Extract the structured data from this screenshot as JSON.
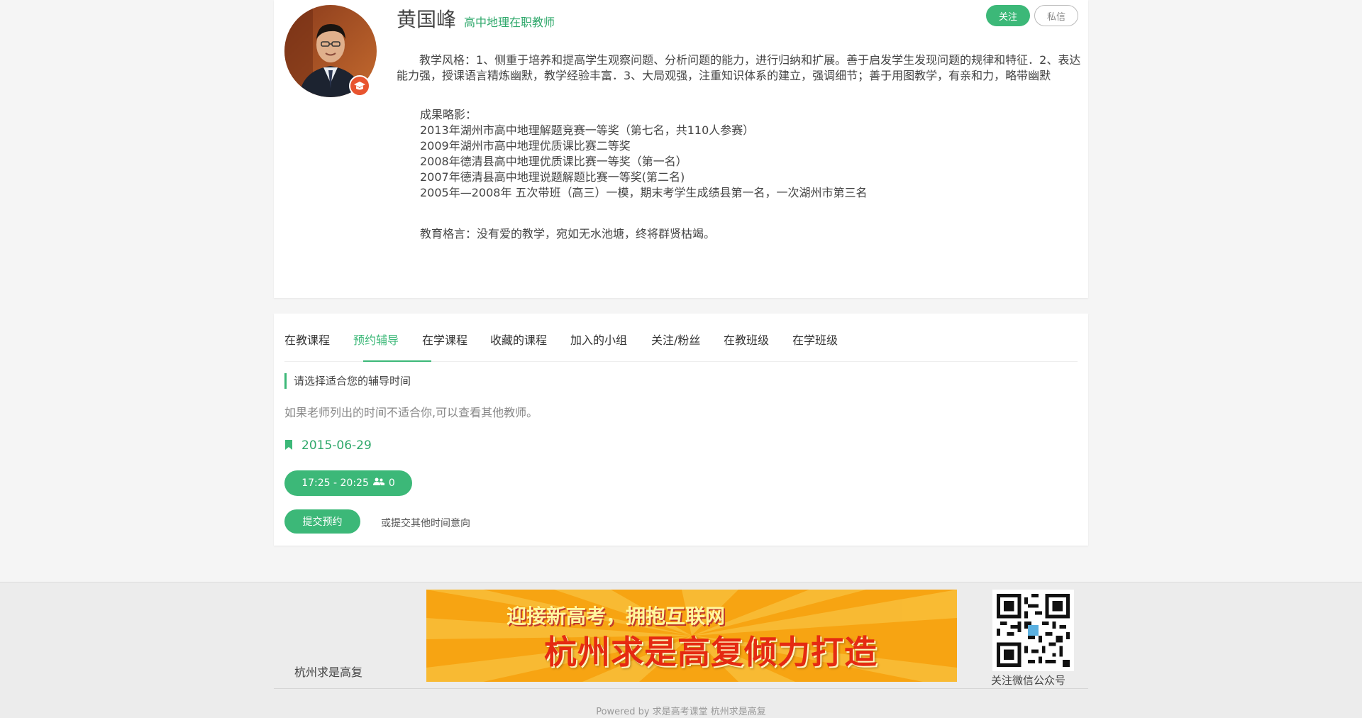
{
  "profile": {
    "name": "黄国峰",
    "role": "高中地理在职教师",
    "follow_label": "关注",
    "message_label": "私信",
    "teaching_style": "教学风格：1、侧重于培养和提高学生观察问题、分析问题的能力，进行归纳和扩展。善于启发学生发现问题的规律和特征．2、表达能力强，授课语言精炼幽默，教学经验丰富．3、大局观强，注重知识体系的建立，强调细节；善于用图教学，有亲和力，略带幽默",
    "achievements_title": "成果略影：",
    "achievements": [
      "2013年湖州市高中地理解题竞赛一等奖（第七名，共110人参赛）",
      "2009年湖州市高中地理优质课比赛二等奖",
      "2008年德清县高中地理优质课比赛一等奖（第一名）",
      "2007年德清县高中地理说题解题比赛一等奖(第二名)",
      "2005年—2008年 五次带班（高三）一模，期末考学生成绩县第一名，一次湖州市第三名"
    ],
    "motto": "教育格言：没有爱的教学，宛如无水池塘，终将群贤枯竭。"
  },
  "tabs": [
    {
      "label": "在教课程"
    },
    {
      "label": "预约辅导"
    },
    {
      "label": "在学课程"
    },
    {
      "label": "收藏的课程"
    },
    {
      "label": "加入的小组"
    },
    {
      "label": "关注/粉丝"
    },
    {
      "label": "在教班级"
    },
    {
      "label": "在学班级"
    }
  ],
  "booking": {
    "section_title": "请选择适合您的辅导时间",
    "hint": "如果老师列出的时间不适合你,可以查看其他教师。",
    "date": "2015-06-29",
    "slot_time": "17:25 - 20:25",
    "slot_count": "0",
    "submit_label": "提交预约",
    "other_time_label": "或提交其他时间意向"
  },
  "footer": {
    "brand": "杭州求是高复",
    "banner_line1": "迎接新高考，拥抱互联网",
    "banner_line2": "杭州求是高复倾力打造",
    "qr_label": "关注微信公众号",
    "powered": "Powered by 求是高考课堂 杭州求是高复"
  },
  "colors": {
    "accent": "#3cb878",
    "badge": "#e8542f",
    "banner_bg": "#f7a412"
  }
}
